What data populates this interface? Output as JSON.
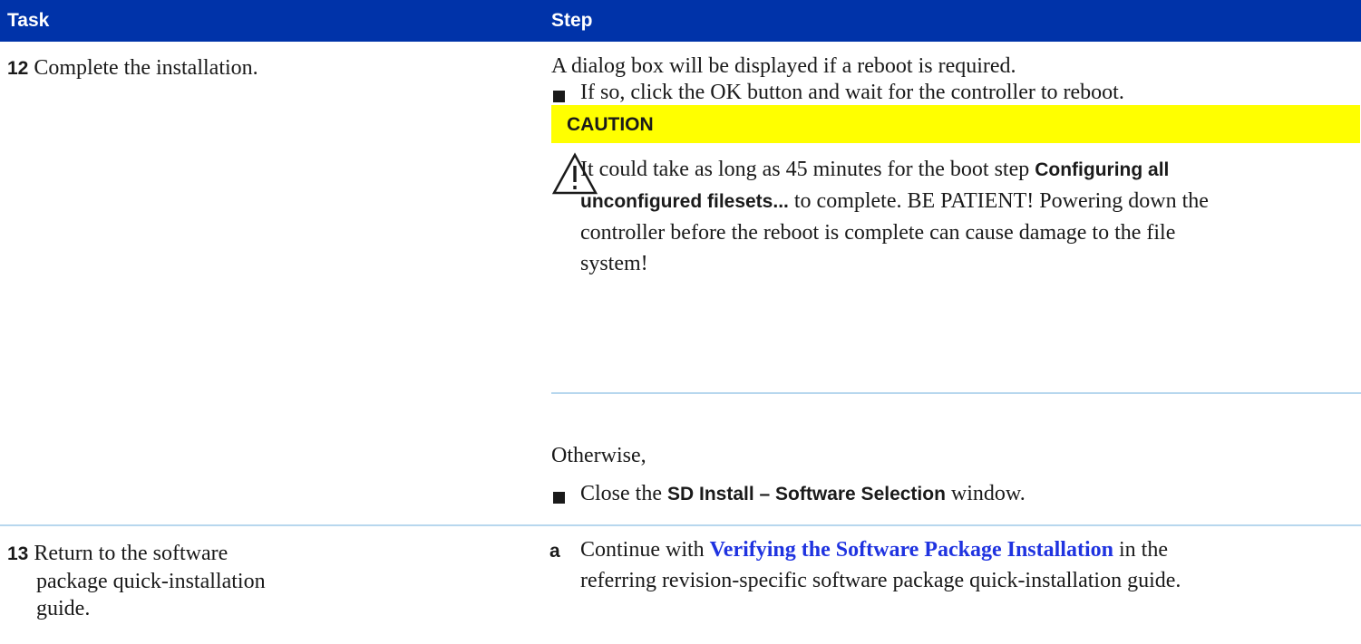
{
  "table_header": {
    "task": "Task",
    "step": "Step"
  },
  "row12": {
    "number": "12",
    "task": "Complete the installation.",
    "intro": "A dialog box will be displayed if a reboot is required.",
    "bullet1": "If so, click the OK button and wait for the controller to reboot.",
    "caution": {
      "label": "CAUTION",
      "icon": "warning-triangle-icon",
      "text_before": "It could take as long as 45 minutes for the boot step ",
      "bold_1": "Configuring all",
      "bold_2": "unconfigured filesets...",
      "text_after_1": " to complete. BE PATIENT! Powering down the",
      "text_line3": "controller before the reboot is complete can cause damage to the file",
      "text_line4": "system!"
    },
    "otherwise": "Otherwise,",
    "bullet2_before": "Close the ",
    "bullet2_bold": "SD Install – Software Selection",
    "bullet2_after": " window."
  },
  "row13": {
    "number": "13",
    "task_line1": "Return to the software",
    "task_line2": "package quick-installation",
    "task_line3": "guide.",
    "step_letter": "a",
    "step_before": "Continue with ",
    "step_link": "Verifying the Software Package Installation",
    "step_after": " in the",
    "step_line2": "referring revision-specific software package quick-installation guide."
  },
  "colors": {
    "header": "#0033a9",
    "caution": "#ffff00",
    "rule": "#b7d7ee",
    "link": "#1f33e0"
  }
}
